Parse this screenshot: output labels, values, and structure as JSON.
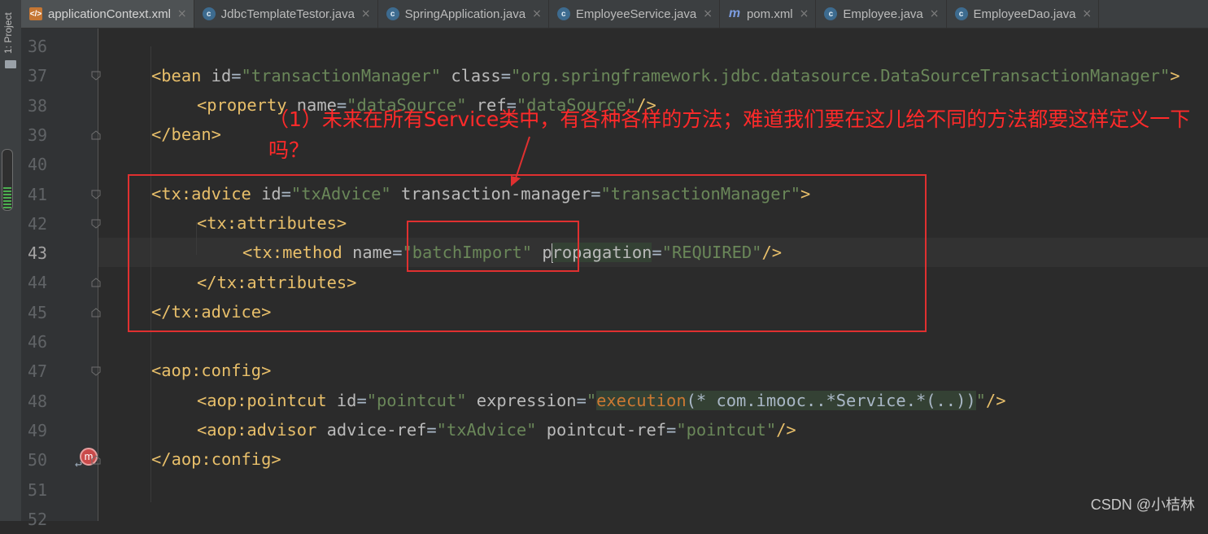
{
  "tabs": [
    {
      "label": "applicationContext.xml",
      "icon": "xml-file-icon",
      "active": true
    },
    {
      "label": "JdbcTemplateTestor.java",
      "icon": "java-class-icon"
    },
    {
      "label": "SpringApplication.java",
      "icon": "java-class-icon"
    },
    {
      "label": "EmployeeService.java",
      "icon": "java-class-icon"
    },
    {
      "label": "pom.xml",
      "icon": "maven-icon"
    },
    {
      "label": "Employee.java",
      "icon": "java-class-icon"
    },
    {
      "label": "EmployeeDao.java",
      "icon": "java-class-icon"
    }
  ],
  "tool_window": {
    "project_label": "1: Project"
  },
  "line_numbers": [
    "36",
    "37",
    "38",
    "39",
    "40",
    "41",
    "42",
    "43",
    "44",
    "45",
    "46",
    "47",
    "48",
    "49",
    "50",
    "51",
    "52"
  ],
  "current_line": "43",
  "code": {
    "l37": {
      "open": "<",
      "tag": "bean",
      "a1": "id",
      "v1": "\"transactionManager\"",
      "a2": "class",
      "v2": "\"org.springframework.jdbc.datasource.DataSourceTransactionManager\"",
      "close": ">"
    },
    "l38": {
      "open": "<",
      "tag": "property",
      "a1": "name",
      "v1": "\"dataSource\"",
      "a2": "ref",
      "v2": "\"dataSource\"",
      "close": "/>"
    },
    "l39": {
      "text": "</bean>"
    },
    "l41": {
      "ns": "tx",
      "tag": "advice",
      "a1": "id",
      "v1": "\"txAdvice\"",
      "a2": "transaction-manager",
      "v2": "\"transactionManager\""
    },
    "l42": {
      "ns": "tx",
      "tag": "attributes"
    },
    "l43": {
      "ns": "tx",
      "tag": "method",
      "a1": "name",
      "v1": "\"batchImport\"",
      "a2_pre": "p",
      "a2_post": "ropagation",
      "v2": "\"REQUIRED\""
    },
    "l44": {
      "ns": "tx",
      "tag": "attributes"
    },
    "l45": {
      "ns": "tx",
      "tag": "advice"
    },
    "l47": {
      "ns": "aop",
      "tag": "config"
    },
    "l48": {
      "ns": "aop",
      "tag": "pointcut",
      "a1": "id",
      "v1": "\"pointcut\"",
      "a2": "expression",
      "q": "\"",
      "fn": "execution",
      "expr": "(* com.imooc..*Service.*(..))"
    },
    "l49": {
      "ns": "aop",
      "tag": "advisor",
      "a1": "advice-ref",
      "v1": "\"txAdvice\"",
      "a2": "pointcut-ref",
      "v2": "\"pointcut\""
    },
    "l50": {
      "ns": "aop",
      "tag": "config"
    }
  },
  "annotation": {
    "text": "（1）未来在所有Service类中，有各种各样的方法；难道我们要在这儿给不同的方法都要这样定义一下吗？",
    "color": "#ff2a2a"
  },
  "gutter_marker": {
    "label": "m"
  },
  "watermark": "CSDN @小桔林"
}
